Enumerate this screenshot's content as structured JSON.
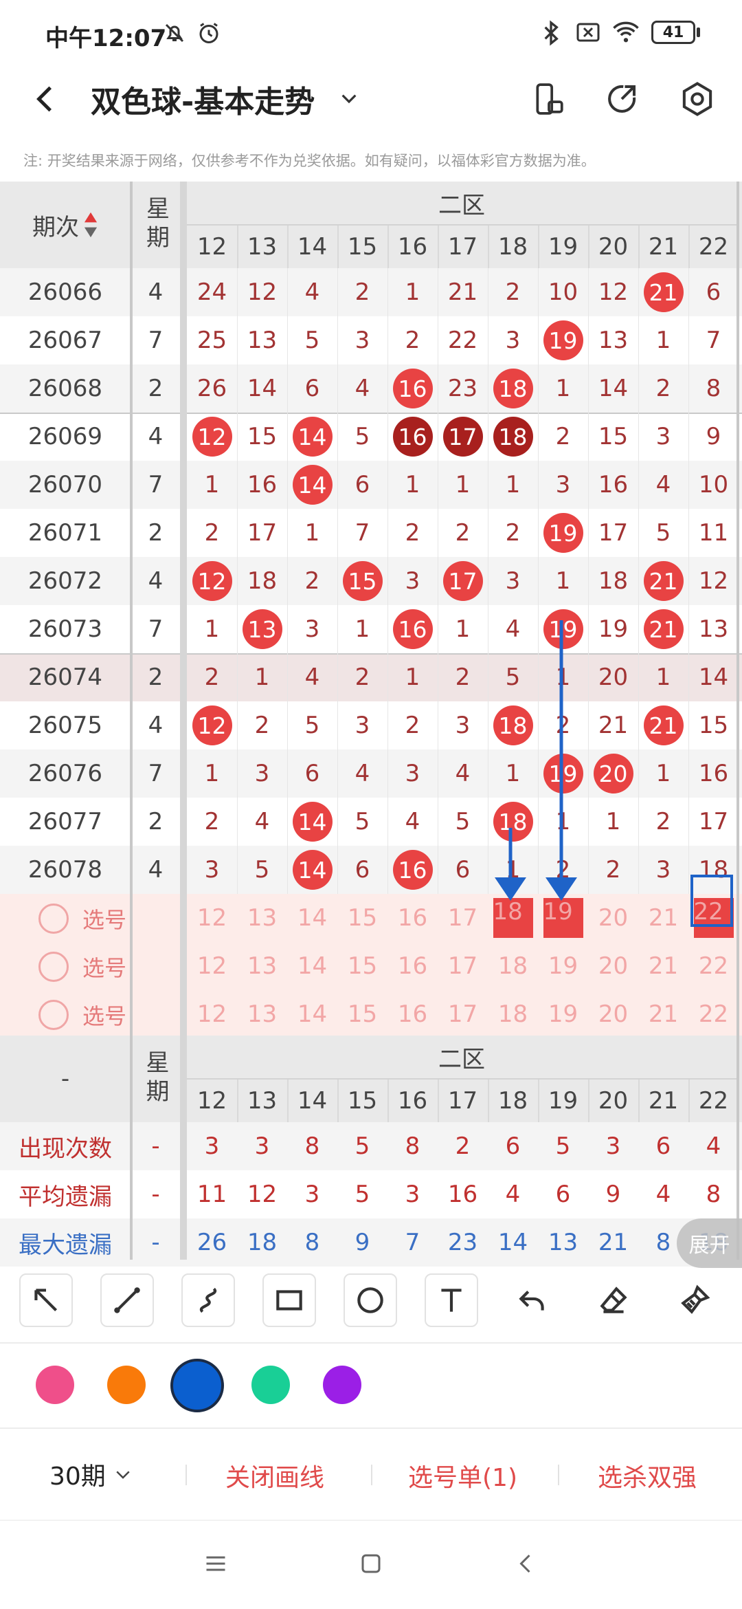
{
  "status_bar": {
    "time": "中午12:07",
    "battery": "41",
    "icons": [
      "mute-bell-icon",
      "alarm-icon",
      "bluetooth-icon",
      "sim-off-icon",
      "wifi-icon",
      "battery-icon"
    ]
  },
  "app_bar": {
    "title": "双色球-基本走势"
  },
  "notice": "注: 开奖结果来源于网络，仅供参考不作为兑奖依据。如有疑问，以福体彩官方数据为准。",
  "table": {
    "period_header": "期次",
    "week_header": "星期",
    "zone_label": "二区",
    "columns": [
      "12",
      "13",
      "14",
      "15",
      "16",
      "17",
      "18",
      "19",
      "20",
      "21",
      "22"
    ],
    "rows": [
      {
        "period": "26066",
        "week": "4",
        "cells": [
          "24",
          "12",
          "4",
          "2",
          "1",
          "21",
          "2",
          "10",
          "12",
          "21",
          "6"
        ],
        "hits": [
          "",
          "",
          "",
          "",
          "",
          "",
          "",
          "",
          "",
          "red",
          ""
        ]
      },
      {
        "period": "26067",
        "week": "7",
        "cells": [
          "25",
          "13",
          "5",
          "3",
          "2",
          "22",
          "3",
          "19",
          "13",
          "1",
          "7"
        ],
        "hits": [
          "",
          "",
          "",
          "",
          "",
          "",
          "",
          "red",
          "",
          "",
          ""
        ]
      },
      {
        "period": "26068",
        "week": "2",
        "cells": [
          "26",
          "14",
          "6",
          "4",
          "16",
          "23",
          "18",
          "1",
          "14",
          "2",
          "8"
        ],
        "hits": [
          "",
          "",
          "",
          "",
          "red",
          "",
          "red",
          "",
          "",
          "",
          ""
        ]
      },
      {
        "period": "26069",
        "week": "4",
        "cells": [
          "12",
          "15",
          "14",
          "5",
          "16",
          "17",
          "18",
          "2",
          "15",
          "3",
          "9"
        ],
        "hits": [
          "red",
          "",
          "red",
          "",
          "dark",
          "dark",
          "dark",
          "",
          "",
          "",
          ""
        ]
      },
      {
        "period": "26070",
        "week": "7",
        "cells": [
          "1",
          "16",
          "14",
          "6",
          "1",
          "1",
          "1",
          "3",
          "16",
          "4",
          "10"
        ],
        "hits": [
          "",
          "",
          "red",
          "",
          "",
          "",
          "",
          "",
          "",
          "",
          ""
        ]
      },
      {
        "period": "26071",
        "week": "2",
        "cells": [
          "2",
          "17",
          "1",
          "7",
          "2",
          "2",
          "2",
          "19",
          "17",
          "5",
          "11"
        ],
        "hits": [
          "",
          "",
          "",
          "",
          "",
          "",
          "",
          "red",
          "",
          "",
          ""
        ]
      },
      {
        "period": "26072",
        "week": "4",
        "cells": [
          "12",
          "18",
          "2",
          "15",
          "3",
          "17",
          "3",
          "1",
          "18",
          "21",
          "12"
        ],
        "hits": [
          "red",
          "",
          "",
          "red",
          "",
          "red",
          "",
          "",
          "",
          "red",
          ""
        ]
      },
      {
        "period": "26073",
        "week": "7",
        "cells": [
          "1",
          "13",
          "3",
          "1",
          "16",
          "1",
          "4",
          "19",
          "19",
          "21",
          "13"
        ],
        "hits": [
          "",
          "red",
          "",
          "",
          "red",
          "",
          "",
          "red",
          "",
          "red",
          ""
        ]
      },
      {
        "period": "26074",
        "week": "2",
        "cells": [
          "2",
          "1",
          "4",
          "2",
          "1",
          "2",
          "5",
          "1",
          "20",
          "1",
          "14"
        ],
        "hits": [
          "",
          "",
          "",
          "",
          "",
          "",
          "",
          "",
          "",
          "",
          ""
        ]
      },
      {
        "period": "26075",
        "week": "4",
        "cells": [
          "12",
          "2",
          "5",
          "3",
          "2",
          "3",
          "18",
          "2",
          "21",
          "21",
          "15"
        ],
        "hits": [
          "red",
          "",
          "",
          "",
          "",
          "",
          "red",
          "",
          "",
          "red",
          ""
        ]
      },
      {
        "period": "26076",
        "week": "7",
        "cells": [
          "1",
          "3",
          "6",
          "4",
          "3",
          "4",
          "1",
          "19",
          "20",
          "1",
          "16"
        ],
        "hits": [
          "",
          "",
          "",
          "",
          "",
          "",
          "",
          "red",
          "red",
          "",
          ""
        ]
      },
      {
        "period": "26077",
        "week": "2",
        "cells": [
          "2",
          "4",
          "14",
          "5",
          "4",
          "5",
          "18",
          "1",
          "1",
          "2",
          "17"
        ],
        "hits": [
          "",
          "",
          "red",
          "",
          "",
          "",
          "red",
          "",
          "",
          "",
          ""
        ]
      },
      {
        "period": "26078",
        "week": "4",
        "cells": [
          "3",
          "5",
          "14",
          "6",
          "16",
          "6",
          "1",
          "2",
          "2",
          "3",
          "18"
        ],
        "hits": [
          "",
          "",
          "red",
          "",
          "red",
          "",
          "",
          "",
          "",
          "",
          ""
        ]
      }
    ],
    "pick_rows": [
      {
        "label": "选号",
        "cells": [
          "12",
          "13",
          "14",
          "15",
          "16",
          "17",
          "18",
          "19",
          "20",
          "21",
          "22"
        ],
        "selected": [
          "",
          "",
          "",
          "",
          "",
          "",
          "red",
          "red",
          "",
          "",
          "red"
        ]
      },
      {
        "label": "选号",
        "cells": [
          "12",
          "13",
          "14",
          "15",
          "16",
          "17",
          "18",
          "19",
          "20",
          "21",
          "22"
        ],
        "selected": [
          "",
          "",
          "",
          "",
          "",
          "",
          "",
          "",
          "",
          "",
          ""
        ]
      },
      {
        "label": "选号",
        "cells": [
          "12",
          "13",
          "14",
          "15",
          "16",
          "17",
          "18",
          "19",
          "20",
          "21",
          "22"
        ],
        "selected": [
          "",
          "",
          "",
          "",
          "",
          "",
          "",
          "",
          "",
          "",
          ""
        ]
      }
    ],
    "footer_header": {
      "label": "-",
      "week_header": "星期",
      "zone_label": "二区"
    },
    "stats": [
      {
        "label": "出现次数",
        "dash": "-",
        "color": "#c0302f",
        "values": [
          "3",
          "3",
          "8",
          "5",
          "8",
          "2",
          "6",
          "5",
          "3",
          "6",
          "4"
        ]
      },
      {
        "label": "平均遗漏",
        "dash": "-",
        "color": "#c0302f",
        "values": [
          "11",
          "12",
          "3",
          "5",
          "3",
          "16",
          "4",
          "6",
          "9",
          "4",
          "8"
        ]
      },
      {
        "label": "最大遗漏",
        "dash": "-",
        "color": "#3a6fc4",
        "values": [
          "26",
          "18",
          "8",
          "9",
          "7",
          "23",
          "14",
          "13",
          "21",
          "8",
          "18"
        ]
      }
    ],
    "expand_label": "展开"
  },
  "drawing": {
    "tools": [
      "arrow-tool-icon",
      "line-tool-icon",
      "curve-tool-icon",
      "rectangle-tool-icon",
      "circle-tool-icon",
      "text-tool-icon",
      "undo-icon",
      "eraser-icon",
      "clear-brush-icon"
    ],
    "colors": [
      "#ef4f8a",
      "#f97a0a",
      "#0b5fcf",
      "#19cf96",
      "#9b1fe6"
    ],
    "selected_color": "#0b5fcf"
  },
  "bottom_bar": {
    "periods": "30期",
    "close_lines": "关闭画线",
    "pick_list": "选号单(1)",
    "kill_strong": "选杀双强"
  }
}
